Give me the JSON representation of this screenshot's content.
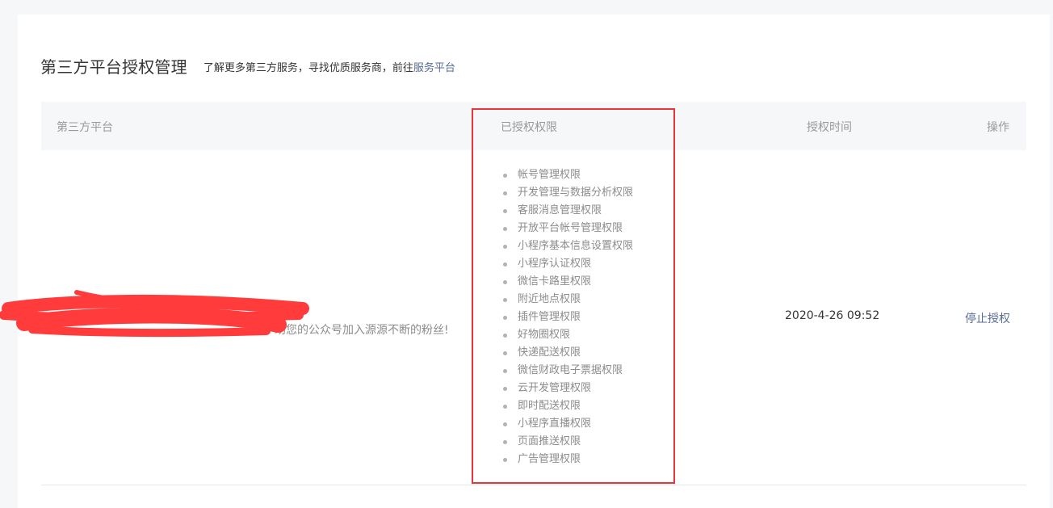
{
  "header": {
    "title": "第三方平台授权管理",
    "tip_prefix": "了解更多第三方服务，寻找优质服务商，前往",
    "tip_link": "服务平台"
  },
  "table": {
    "columns": [
      "第三方平台",
      "已授权权限",
      "授权时间",
      "操作"
    ]
  },
  "row": {
    "platform_desc": "助您的公众号加入源源不断的粉丝!",
    "permissions": [
      "帐号管理权限",
      "开发管理与数据分析权限",
      "客服消息管理权限",
      "开放平台帐号管理权限",
      "小程序基本信息设置权限",
      "小程序认证权限",
      "微信卡路里权限",
      "附近地点权限",
      "插件管理权限",
      "好物圈权限",
      "快递配送权限",
      "微信财政电子票据权限",
      "云开发管理权限",
      "即时配送权限",
      "小程序直播权限",
      "页面推送权限",
      "广告管理权限"
    ],
    "auth_time": "2020-4-26 09:52",
    "action_label": "停止授权"
  },
  "colors": {
    "link": "#576b95",
    "highlight_border": "#e8343a",
    "scribble": "#ff3b3b"
  }
}
